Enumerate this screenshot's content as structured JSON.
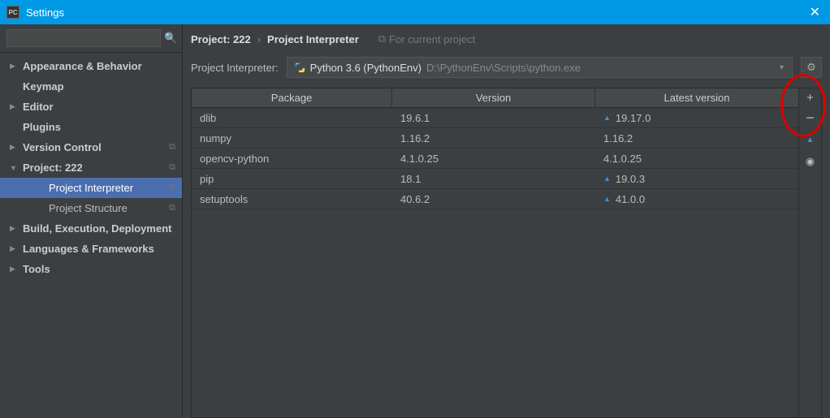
{
  "titlebar": {
    "appicon": "PC",
    "title": "Settings"
  },
  "search": {
    "placeholder": ""
  },
  "tree": [
    {
      "arrow": "▶",
      "label": "Appearance & Behavior",
      "bold": true
    },
    {
      "arrow": "",
      "label": "Keymap",
      "bold": true
    },
    {
      "arrow": "▶",
      "label": "Editor",
      "bold": true
    },
    {
      "arrow": "",
      "label": "Plugins",
      "bold": true
    },
    {
      "arrow": "▶",
      "label": "Version Control",
      "bold": true,
      "copy": true
    },
    {
      "arrow": "▼",
      "label": "Project: 222",
      "bold": true,
      "copy": true
    },
    {
      "arrow": "",
      "label": "Project Interpreter",
      "child": true,
      "selected": true,
      "copy": true
    },
    {
      "arrow": "",
      "label": "Project Structure",
      "child": true,
      "copy": true
    },
    {
      "arrow": "▶",
      "label": "Build, Execution, Deployment",
      "bold": true
    },
    {
      "arrow": "▶",
      "label": "Languages & Frameworks",
      "bold": true
    },
    {
      "arrow": "▶",
      "label": "Tools",
      "bold": true
    }
  ],
  "breadcrumb": {
    "a": "Project: 222",
    "b": "Project Interpreter",
    "hint": "For current project"
  },
  "interpreter": {
    "label": "Project Interpreter:",
    "name": "Python 3.6 (PythonEnv)",
    "path": "D:\\PythonEnv\\Scripts\\python.exe"
  },
  "table": {
    "headers": {
      "pkg": "Package",
      "ver": "Version",
      "lat": "Latest version"
    },
    "rows": [
      {
        "pkg": "dlib",
        "ver": "19.6.1",
        "lat": "19.17.0",
        "up": true
      },
      {
        "pkg": "numpy",
        "ver": "1.16.2",
        "lat": "1.16.2",
        "up": false
      },
      {
        "pkg": "opencv-python",
        "ver": "4.1.0.25",
        "lat": "4.1.0.25",
        "up": false
      },
      {
        "pkg": "pip",
        "ver": "18.1",
        "lat": "19.0.3",
        "up": true
      },
      {
        "pkg": "setuptools",
        "ver": "40.6.2",
        "lat": "41.0.0",
        "up": true
      }
    ]
  },
  "sidebtns": {
    "add": "+",
    "remove": "−",
    "up": "▲",
    "eye": "◉"
  }
}
